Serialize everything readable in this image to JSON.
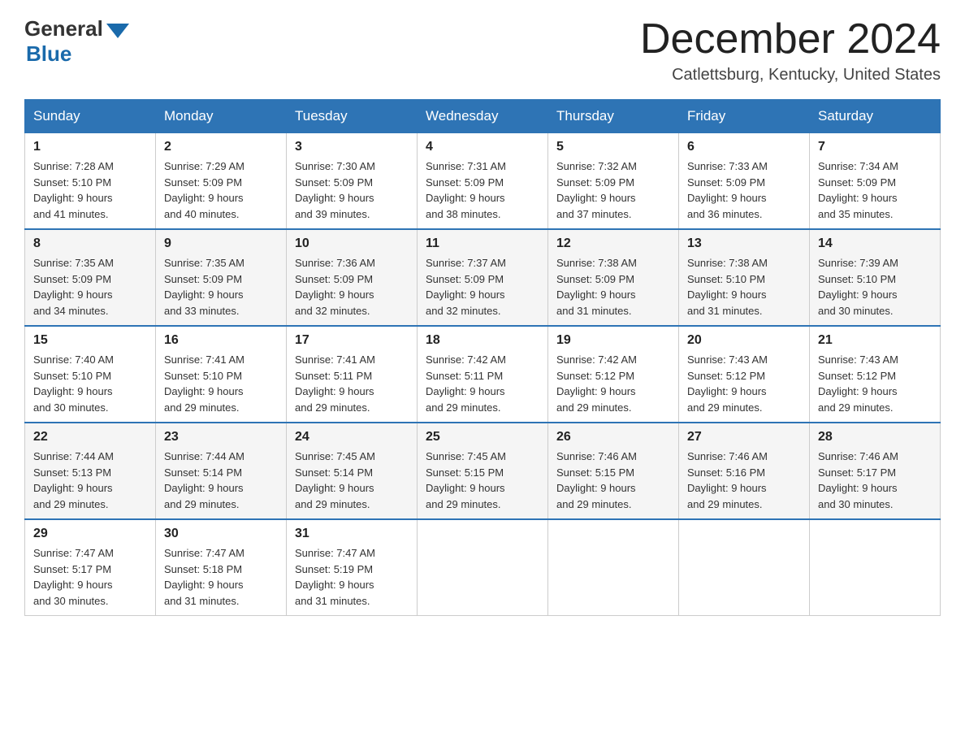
{
  "header": {
    "logo_general": "General",
    "logo_blue": "Blue",
    "month_title": "December 2024",
    "location": "Catlettsburg, Kentucky, United States"
  },
  "days_of_week": [
    "Sunday",
    "Monday",
    "Tuesday",
    "Wednesday",
    "Thursday",
    "Friday",
    "Saturday"
  ],
  "weeks": [
    [
      {
        "day": "1",
        "sunrise": "7:28 AM",
        "sunset": "5:10 PM",
        "daylight": "9 hours and 41 minutes."
      },
      {
        "day": "2",
        "sunrise": "7:29 AM",
        "sunset": "5:09 PM",
        "daylight": "9 hours and 40 minutes."
      },
      {
        "day": "3",
        "sunrise": "7:30 AM",
        "sunset": "5:09 PM",
        "daylight": "9 hours and 39 minutes."
      },
      {
        "day": "4",
        "sunrise": "7:31 AM",
        "sunset": "5:09 PM",
        "daylight": "9 hours and 38 minutes."
      },
      {
        "day": "5",
        "sunrise": "7:32 AM",
        "sunset": "5:09 PM",
        "daylight": "9 hours and 37 minutes."
      },
      {
        "day": "6",
        "sunrise": "7:33 AM",
        "sunset": "5:09 PM",
        "daylight": "9 hours and 36 minutes."
      },
      {
        "day": "7",
        "sunrise": "7:34 AM",
        "sunset": "5:09 PM",
        "daylight": "9 hours and 35 minutes."
      }
    ],
    [
      {
        "day": "8",
        "sunrise": "7:35 AM",
        "sunset": "5:09 PM",
        "daylight": "9 hours and 34 minutes."
      },
      {
        "day": "9",
        "sunrise": "7:35 AM",
        "sunset": "5:09 PM",
        "daylight": "9 hours and 33 minutes."
      },
      {
        "day": "10",
        "sunrise": "7:36 AM",
        "sunset": "5:09 PM",
        "daylight": "9 hours and 32 minutes."
      },
      {
        "day": "11",
        "sunrise": "7:37 AM",
        "sunset": "5:09 PM",
        "daylight": "9 hours and 32 minutes."
      },
      {
        "day": "12",
        "sunrise": "7:38 AM",
        "sunset": "5:09 PM",
        "daylight": "9 hours and 31 minutes."
      },
      {
        "day": "13",
        "sunrise": "7:38 AM",
        "sunset": "5:10 PM",
        "daylight": "9 hours and 31 minutes."
      },
      {
        "day": "14",
        "sunrise": "7:39 AM",
        "sunset": "5:10 PM",
        "daylight": "9 hours and 30 minutes."
      }
    ],
    [
      {
        "day": "15",
        "sunrise": "7:40 AM",
        "sunset": "5:10 PM",
        "daylight": "9 hours and 30 minutes."
      },
      {
        "day": "16",
        "sunrise": "7:41 AM",
        "sunset": "5:10 PM",
        "daylight": "9 hours and 29 minutes."
      },
      {
        "day": "17",
        "sunrise": "7:41 AM",
        "sunset": "5:11 PM",
        "daylight": "9 hours and 29 minutes."
      },
      {
        "day": "18",
        "sunrise": "7:42 AM",
        "sunset": "5:11 PM",
        "daylight": "9 hours and 29 minutes."
      },
      {
        "day": "19",
        "sunrise": "7:42 AM",
        "sunset": "5:12 PM",
        "daylight": "9 hours and 29 minutes."
      },
      {
        "day": "20",
        "sunrise": "7:43 AM",
        "sunset": "5:12 PM",
        "daylight": "9 hours and 29 minutes."
      },
      {
        "day": "21",
        "sunrise": "7:43 AM",
        "sunset": "5:12 PM",
        "daylight": "9 hours and 29 minutes."
      }
    ],
    [
      {
        "day": "22",
        "sunrise": "7:44 AM",
        "sunset": "5:13 PM",
        "daylight": "9 hours and 29 minutes."
      },
      {
        "day": "23",
        "sunrise": "7:44 AM",
        "sunset": "5:14 PM",
        "daylight": "9 hours and 29 minutes."
      },
      {
        "day": "24",
        "sunrise": "7:45 AM",
        "sunset": "5:14 PM",
        "daylight": "9 hours and 29 minutes."
      },
      {
        "day": "25",
        "sunrise": "7:45 AM",
        "sunset": "5:15 PM",
        "daylight": "9 hours and 29 minutes."
      },
      {
        "day": "26",
        "sunrise": "7:46 AM",
        "sunset": "5:15 PM",
        "daylight": "9 hours and 29 minutes."
      },
      {
        "day": "27",
        "sunrise": "7:46 AM",
        "sunset": "5:16 PM",
        "daylight": "9 hours and 29 minutes."
      },
      {
        "day": "28",
        "sunrise": "7:46 AM",
        "sunset": "5:17 PM",
        "daylight": "9 hours and 30 minutes."
      }
    ],
    [
      {
        "day": "29",
        "sunrise": "7:47 AM",
        "sunset": "5:17 PM",
        "daylight": "9 hours and 30 minutes."
      },
      {
        "day": "30",
        "sunrise": "7:47 AM",
        "sunset": "5:18 PM",
        "daylight": "9 hours and 31 minutes."
      },
      {
        "day": "31",
        "sunrise": "7:47 AM",
        "sunset": "5:19 PM",
        "daylight": "9 hours and 31 minutes."
      },
      null,
      null,
      null,
      null
    ]
  ],
  "labels": {
    "sunrise_prefix": "Sunrise: ",
    "sunset_prefix": "Sunset: ",
    "daylight_prefix": "Daylight: "
  }
}
